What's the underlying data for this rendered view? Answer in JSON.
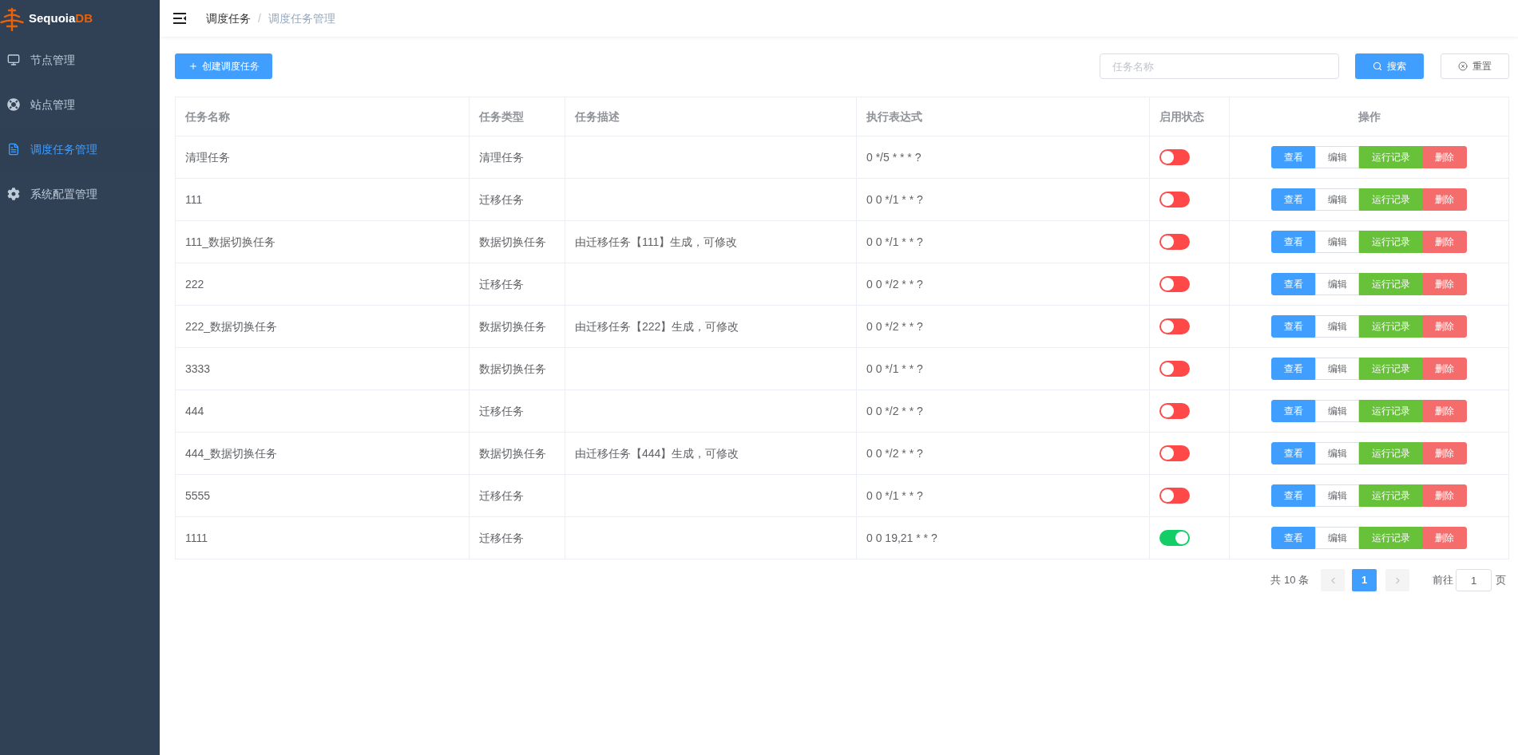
{
  "sidebar": {
    "logo": {
      "text": "Sequoia",
      "accent": "DB"
    },
    "items": [
      {
        "label": "节点管理",
        "selected": false
      },
      {
        "label": "站点管理",
        "selected": false
      },
      {
        "label": "调度任务管理",
        "selected": true
      },
      {
        "label": "系统配置管理",
        "selected": false
      }
    ]
  },
  "topbar": {
    "breadcrumb": [
      {
        "label": "调度任务",
        "current": false
      },
      {
        "label": "调度任务管理",
        "current": true
      }
    ],
    "separator": "/"
  },
  "toolbar": {
    "create_button": "创建调度任务",
    "search": {
      "placeholder": "任务名称"
    },
    "search_button": "搜索",
    "reset_button": "重置"
  },
  "table": {
    "columns": [
      "任务名称",
      "任务类型",
      "任务描述",
      "执行表达式",
      "启用状态",
      "操作"
    ],
    "rows": [
      {
        "name": "清理任务",
        "type": "清理任务",
        "expression": "0 */5 * * * ?",
        "enabled": false,
        "actions": [
          {
            "label": "查看",
            "kind": "view"
          },
          {
            "label": "编辑",
            "kind": "edit"
          },
          {
            "label": "运行记录",
            "kind": "history"
          },
          {
            "label": "删除",
            "kind": "delete"
          }
        ]
      },
      {
        "name": "111",
        "type": "迁移任务",
        "expression": "0 0 */1 * * ?",
        "enabled": false,
        "actions": [
          {
            "label": "查看",
            "kind": "view"
          },
          {
            "label": "编辑",
            "kind": "edit"
          },
          {
            "label": "运行记录",
            "kind": "history"
          },
          {
            "label": "删除",
            "kind": "delete"
          }
        ]
      },
      {
        "name": "111_数据切换任务",
        "type": "数据切换任务",
        "description": "由迁移任务【111】生成，可修改",
        "expression": "0 0 */1 * * ?",
        "enabled": false,
        "actions": [
          {
            "label": "查看",
            "kind": "view"
          },
          {
            "label": "编辑",
            "kind": "edit"
          },
          {
            "label": "运行记录",
            "kind": "history"
          },
          {
            "label": "删除",
            "kind": "delete"
          }
        ]
      },
      {
        "name": "222",
        "type": "迁移任务",
        "expression": "0 0 */2 * * ?",
        "enabled": false,
        "actions": [
          {
            "label": "查看",
            "kind": "view"
          },
          {
            "label": "编辑",
            "kind": "edit"
          },
          {
            "label": "运行记录",
            "kind": "history"
          },
          {
            "label": "删除",
            "kind": "delete"
          }
        ]
      },
      {
        "name": "222_数据切换任务",
        "type": "数据切换任务",
        "description": "由迁移任务【222】生成，可修改",
        "expression": "0 0 */2 * * ?",
        "enabled": false,
        "actions": [
          {
            "label": "查看",
            "kind": "view"
          },
          {
            "label": "编辑",
            "kind": "edit"
          },
          {
            "label": "运行记录",
            "kind": "history"
          },
          {
            "label": "删除",
            "kind": "delete"
          }
        ]
      },
      {
        "name": "3333",
        "type": "数据切换任务",
        "expression": "0 0 */1 * * ?",
        "enabled": false,
        "actions": [
          {
            "label": "查看",
            "kind": "view"
          },
          {
            "label": "编辑",
            "kind": "edit"
          },
          {
            "label": "运行记录",
            "kind": "history"
          },
          {
            "label": "删除",
            "kind": "delete"
          }
        ]
      },
      {
        "name": "444",
        "type": "迁移任务",
        "expression": "0 0 */2 * * ?",
        "enabled": false,
        "actions": [
          {
            "label": "查看",
            "kind": "view"
          },
          {
            "label": "编辑",
            "kind": "edit"
          },
          {
            "label": "运行记录",
            "kind": "history"
          },
          {
            "label": "删除",
            "kind": "delete"
          }
        ]
      },
      {
        "name": "444_数据切换任务",
        "type": "数据切换任务",
        "description": "由迁移任务【444】生成，可修改",
        "expression": "0 0 */2 * * ?",
        "enabled": false,
        "actions": [
          {
            "label": "查看",
            "kind": "view"
          },
          {
            "label": "编辑",
            "kind": "edit"
          },
          {
            "label": "运行记录",
            "kind": "history"
          },
          {
            "label": "删除",
            "kind": "delete"
          }
        ]
      },
      {
        "name": "5555",
        "type": "迁移任务",
        "expression": "0 0 */1 * * ?",
        "enabled": false,
        "actions": [
          {
            "label": "查看",
            "kind": "view"
          },
          {
            "label": "编辑",
            "kind": "edit"
          },
          {
            "label": "运行记录",
            "kind": "history"
          },
          {
            "label": "删除",
            "kind": "delete"
          }
        ]
      },
      {
        "name": "1111",
        "type": "迁移任务",
        "expression": "0 0 19,21 * * ?",
        "enabled": true,
        "actions": [
          {
            "label": "查看",
            "kind": "view"
          },
          {
            "label": "编辑",
            "kind": "edit"
          },
          {
            "label": "运行记录",
            "kind": "history"
          },
          {
            "label": "删除",
            "kind": "delete"
          }
        ]
      }
    ]
  },
  "pagination": {
    "total": "共 10 条",
    "prev": {
      "disabled": true
    },
    "pages": [
      {
        "label": "1",
        "selected": true
      }
    ],
    "next": {
      "disabled": true
    },
    "goto_label": "前往",
    "goto_value": "1",
    "page_suffix": "页"
  }
}
